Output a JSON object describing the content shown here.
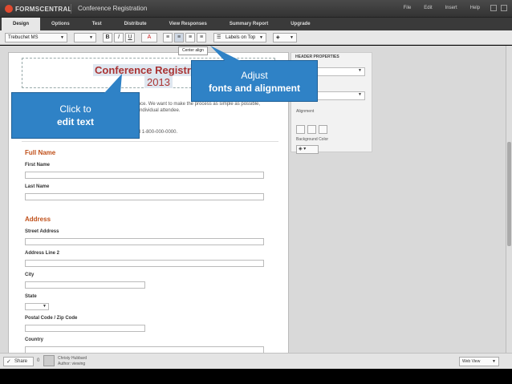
{
  "app": {
    "logo_text": "FORMSCENTRAL",
    "doc_title": "Conference Registration",
    "menu": [
      "File",
      "Edit",
      "Insert",
      "Help"
    ]
  },
  "tabs": [
    "Design",
    "Options",
    "Test",
    "Distribute",
    "View Responses",
    "Summary Report",
    "Upgrade"
  ],
  "toolbar": {
    "font": "Trebuchet MS",
    "bold": "B",
    "italic": "I",
    "underline": "U",
    "font_color": "A",
    "labels_position": "Labels on Top",
    "tooltip": "Center align"
  },
  "form": {
    "title": "Conference Registration",
    "subtitle": "2013",
    "intro": "Thank you for registering for the 2013 annual Conference. We want to make the process as simple as possible, please complete a separate registration form for each individual attendee.",
    "intro2": "If you have any questions about registration please call 1-800-000-0000.",
    "sections": [
      {
        "heading": "Full Name",
        "fields": [
          "First Name",
          "Last Name"
        ]
      },
      {
        "heading": "Address",
        "fields": [
          "Street Address",
          "Address Line 2",
          "City",
          "State",
          "Postal Code / Zip Code",
          "Country"
        ]
      }
    ]
  },
  "properties": {
    "title": "HEADER PROPERTIES",
    "alignment_label": "Alignment",
    "background_label": "Background Color"
  },
  "callouts": {
    "click": {
      "line1": "Click to",
      "line2": "edit text"
    },
    "adjust": {
      "line1": "Adjust",
      "line2": "fonts and alignment"
    }
  },
  "statusbar": {
    "share": "Share",
    "count": "0",
    "user": "Christy Hubbard",
    "author": "Author: viewing",
    "view": "Web View"
  }
}
